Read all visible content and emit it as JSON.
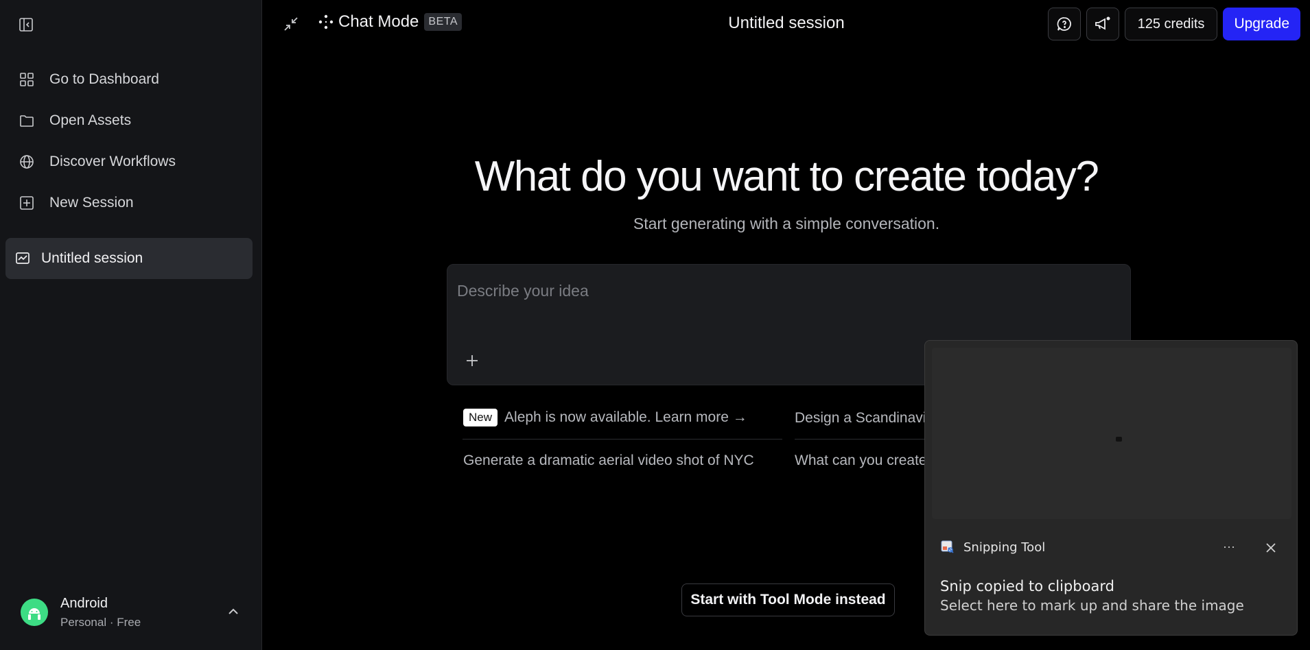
{
  "sidebar": {
    "toggle_icon": "sidebar-panel-icon",
    "items": [
      {
        "label": "Go to Dashboard",
        "icon": "grid-icon"
      },
      {
        "label": "Open Assets",
        "icon": "folder-icon"
      },
      {
        "label": "Discover Workflows",
        "icon": "globe-icon"
      },
      {
        "label": "New Session",
        "icon": "plus-square-icon"
      }
    ],
    "active_session": {
      "label": "Untitled session",
      "icon": "chart-icon"
    },
    "user": {
      "name": "Android",
      "plan": "Personal · Free",
      "avatar_color": "#3ddc84"
    }
  },
  "topbar": {
    "mode_label": "Chat Mode",
    "beta_label": "BETA",
    "session_title": "Untitled session",
    "credits_label": "125 credits",
    "upgrade_label": "Upgrade",
    "upgrade_color": "#2424f5"
  },
  "hero": {
    "title": "What do you want to create today?",
    "subtitle": "Start generating with a simple conversation."
  },
  "prompt": {
    "placeholder": "Describe your idea",
    "value": ""
  },
  "suggestions": {
    "new_badge": "New",
    "items": [
      "Aleph is now available. Learn more →",
      "Design a Scandinavi",
      "Generate a dramatic aerial video shot of NYC",
      "What can you create"
    ]
  },
  "footer": {
    "tool_mode_label": "Start with Tool Mode instead"
  },
  "toast": {
    "app_name": "Snipping Tool",
    "more_label": "···",
    "title": "Snip copied to clipboard",
    "body": "Select here to mark up and share the image"
  }
}
